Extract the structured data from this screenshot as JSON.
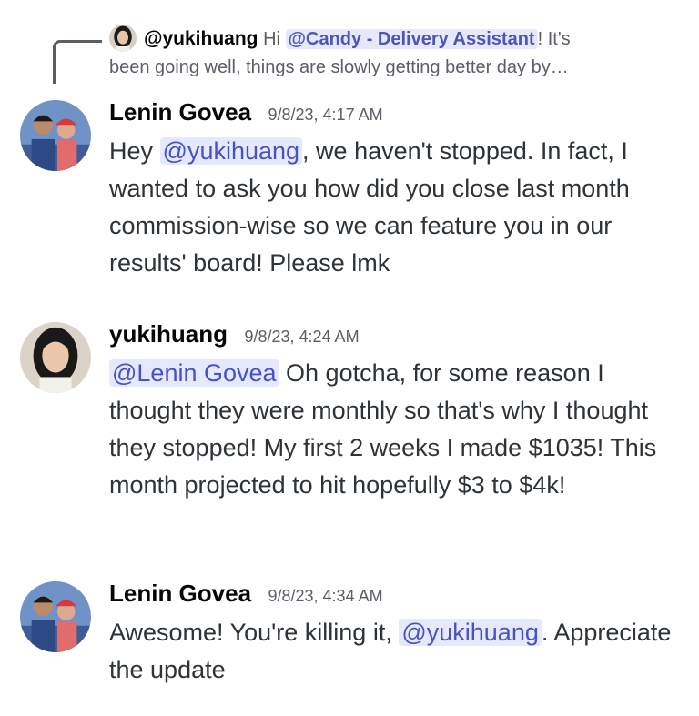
{
  "reply": {
    "author": "@yukihuang",
    "greeting": "Hi",
    "mention": "@Candy - Delivery Assistant",
    "text_line1": "! It's",
    "text_line2": "been going well, things are slowly getting better day by…"
  },
  "messages": [
    {
      "author": "Lenin Govea",
      "timestamp": "9/8/23, 4:17 AM",
      "parts": [
        {
          "type": "text",
          "value": "Hey "
        },
        {
          "type": "mention",
          "value": "@yukihuang"
        },
        {
          "type": "text",
          "value": ", we haven't stopped. In fact, I wanted to ask you how did you close last month commission-wise so we can feature you in our results' board! Please lmk"
        }
      ]
    },
    {
      "author": "yukihuang",
      "timestamp": "9/8/23, 4:24 AM",
      "parts": [
        {
          "type": "mention",
          "value": "@Lenin Govea"
        },
        {
          "type": "text",
          "value": " Oh gotcha, for some reason I thought they were monthly so that's why I thought they stopped! My first 2 weeks I made $1035! This month projected to hit hopefully $3 to $4k!"
        }
      ]
    },
    {
      "author": "Lenin Govea",
      "timestamp": "9/8/23, 4:34 AM",
      "parts": [
        {
          "type": "text",
          "value": "Awesome! You're killing it, "
        },
        {
          "type": "mention",
          "value": "@yukihuang"
        },
        {
          "type": "text",
          "value": ". Appreciate the update"
        }
      ]
    }
  ],
  "colors": {
    "mention_bg": "#e6e8fd",
    "mention_text": "#4752c4",
    "timestamp": "#5c5e66",
    "reply_line": "#5c5e66"
  },
  "icons": {
    "lenin_avatar": "avatar-photo-man-with-child",
    "yuki_avatar": "avatar-photo-woman"
  }
}
